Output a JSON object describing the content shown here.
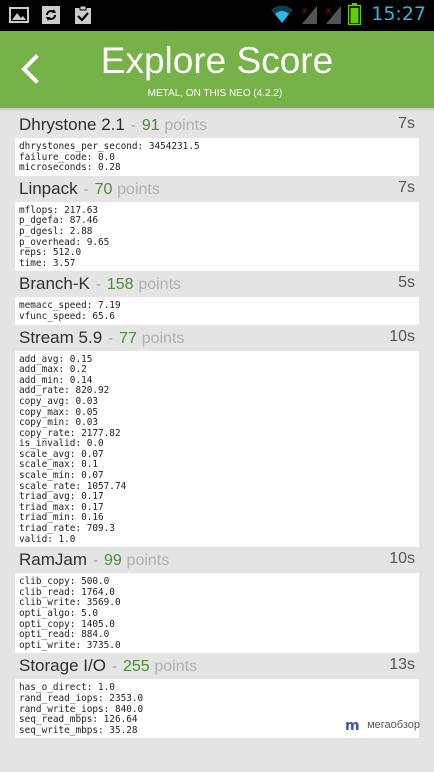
{
  "statusbar": {
    "time": "15:27",
    "icons": [
      "image-icon",
      "sync-icon",
      "clipboard-check-icon",
      "wifi-icon",
      "signal-icon",
      "signal-icon",
      "battery-icon"
    ]
  },
  "header": {
    "title": "Explore Score",
    "subtitle": "METAL, ON THIS NEO (4.2.2)",
    "color": "#76b248"
  },
  "sections": [
    {
      "name": "Dhrystone 2.1",
      "score": "91",
      "points_label": "points",
      "time": "7s",
      "lines": [
        "dhrystones_per_second: 3454231.5",
        "failure_code: 0.0",
        "microseconds: 0.28"
      ]
    },
    {
      "name": "Linpack",
      "score": "70",
      "points_label": "points",
      "time": "7s",
      "lines": [
        "mflops: 217.63",
        "p_dgefa: 87.46",
        "p_dgesl: 2.88",
        "p_overhead: 9.65",
        "reps: 512.0",
        "time: 3.57"
      ]
    },
    {
      "name": "Branch-K",
      "score": "158",
      "points_label": "points",
      "time": "5s",
      "lines": [
        "memacc_speed: 7.19",
        "vfunc_speed: 65.6"
      ]
    },
    {
      "name": "Stream 5.9",
      "score": "77",
      "points_label": "points",
      "time": "10s",
      "lines": [
        "add_avg: 0.15",
        "add_max: 0.2",
        "add_min: 0.14",
        "add_rate: 820.92",
        "copy_avg: 0.03",
        "copy_max: 0.05",
        "copy_min: 0.03",
        "copy_rate: 2177.82",
        "is_invalid: 0.0",
        "scale_avg: 0.07",
        "scale_max: 0.1",
        "scale_min: 0.07",
        "scale_rate: 1057.74",
        "triad_avg: 0.17",
        "triad_max: 0.17",
        "triad_min: 0.16",
        "triad_rate: 709.3",
        "valid: 1.0"
      ]
    },
    {
      "name": "RamJam",
      "score": "99",
      "points_label": "points",
      "time": "10s",
      "lines": [
        "clib_copy: 500.0",
        "clib_read: 1764.0",
        "clib_write: 3569.0",
        "opti_algo: 5.0",
        "opti_copy: 1405.0",
        "opti_read: 884.0",
        "opti_write: 3735.0"
      ]
    },
    {
      "name": "Storage I/O",
      "score": "255",
      "points_label": "points",
      "time": "13s",
      "lines": [
        "has_o_direct: 1.0",
        "rand_read_iops: 2353.0",
        "rand_write_iops: 840.0",
        "seq_read_mbps: 126.64",
        "seq_write_mbps: 35.28"
      ]
    }
  ],
  "watermark": "мегаобзор"
}
